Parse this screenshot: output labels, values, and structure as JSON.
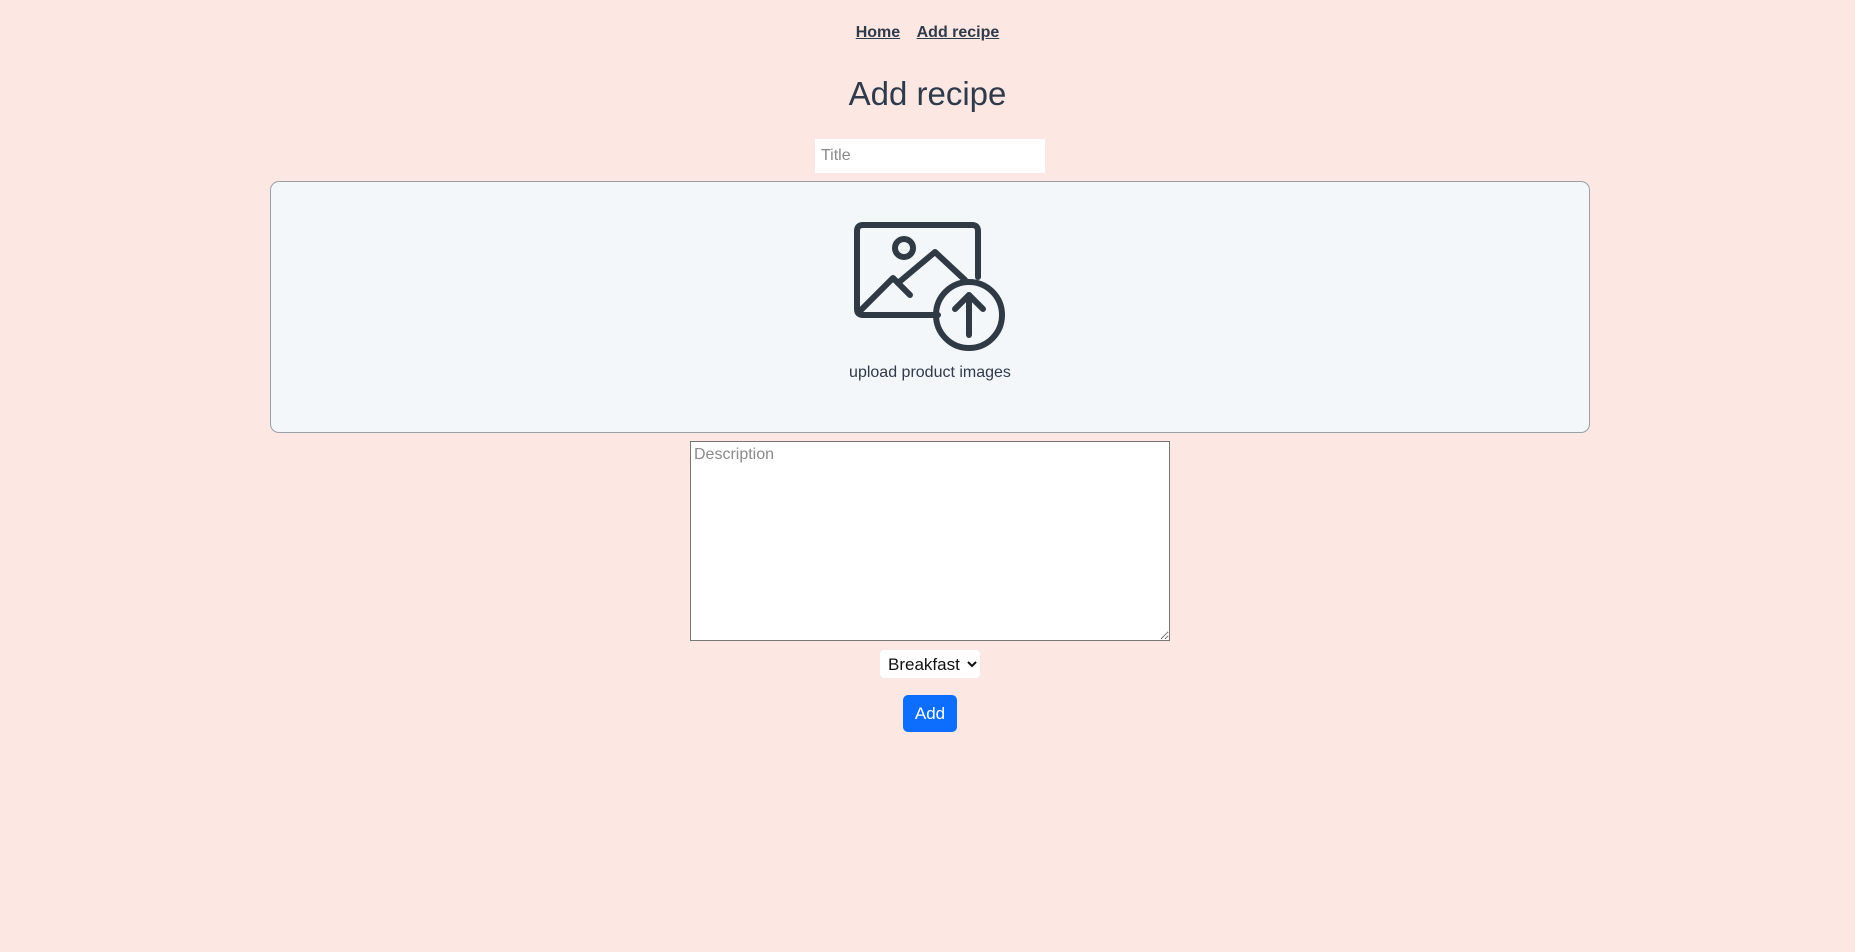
{
  "nav": {
    "items": [
      {
        "label": "Home"
      },
      {
        "label": "Add recipe"
      }
    ]
  },
  "page": {
    "title": "Add recipe"
  },
  "form": {
    "title_placeholder": "Title",
    "upload": {
      "icon": "image-upload-icon",
      "label": "upload product images"
    },
    "description_placeholder": "Description",
    "category": {
      "selected": "Breakfast"
    },
    "submit_label": "Add"
  },
  "colors": {
    "background": "#fce7e3",
    "text": "#2f3a4a",
    "upload_background": "#f4f7fa",
    "button": "#0d6efd"
  }
}
